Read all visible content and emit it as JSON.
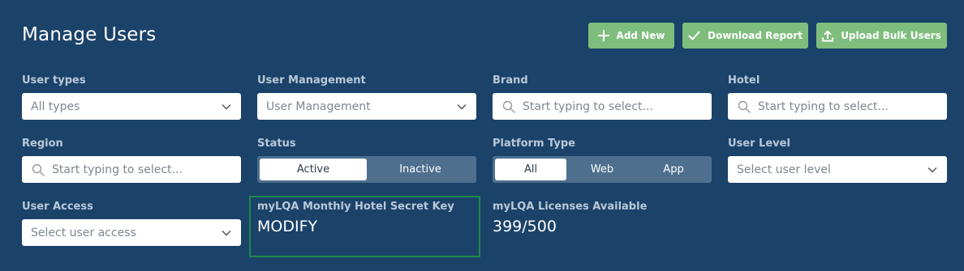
{
  "page": {
    "title": "Manage Users"
  },
  "toolbar": {
    "add_new": "Add New",
    "download_report": "Download Report",
    "upload_bulk_users": "Upload Bulk Users"
  },
  "filters": {
    "user_types": {
      "label": "User types",
      "value": "All types"
    },
    "user_management": {
      "label": "User Management",
      "value": "User Management"
    },
    "brand": {
      "label": "Brand",
      "placeholder": "Start typing to select..."
    },
    "hotel": {
      "label": "Hotel",
      "placeholder": "Start typing to select..."
    },
    "region": {
      "label": "Region",
      "placeholder": "Start typing to select..."
    },
    "status": {
      "label": "Status",
      "options": [
        "Active",
        "Inactive"
      ],
      "selected": "Active"
    },
    "platform_type": {
      "label": "Platform Type",
      "options": [
        "All",
        "Web",
        "App"
      ],
      "selected": "All"
    },
    "user_level": {
      "label": "User Level",
      "placeholder": "Select user level"
    },
    "user_access": {
      "label": "User Access",
      "placeholder": "Select user access"
    }
  },
  "secret_key": {
    "label": "myLQA Monthly Hotel Secret Key",
    "value": "MODIFY"
  },
  "licenses": {
    "label": "myLQA Licenses Available",
    "value": "399/500"
  },
  "colors": {
    "background": "#1b4269",
    "button": "#7fbd7d",
    "label": "#b9c9d9",
    "highlight_border": "#1f8a4c"
  }
}
